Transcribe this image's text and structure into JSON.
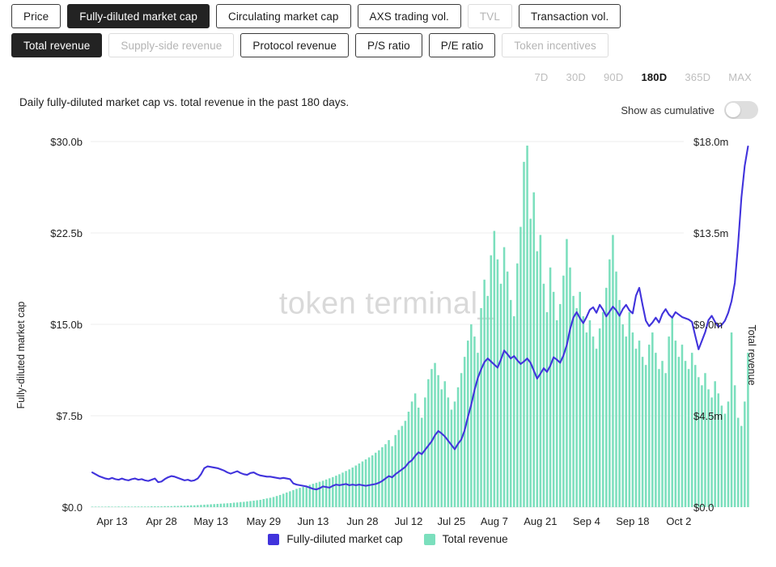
{
  "metric_tabs_row1": [
    {
      "label": "Price",
      "state": "normal"
    },
    {
      "label": "Fully-diluted market cap",
      "state": "active"
    },
    {
      "label": "Circulating market cap",
      "state": "normal"
    },
    {
      "label": "AXS trading vol.",
      "state": "normal"
    },
    {
      "label": "TVL",
      "state": "disabled"
    },
    {
      "label": "Transaction vol.",
      "state": "normal"
    }
  ],
  "metric_tabs_row2": [
    {
      "label": "Total revenue",
      "state": "active"
    },
    {
      "label": "Supply-side revenue",
      "state": "disabled"
    },
    {
      "label": "Protocol revenue",
      "state": "normal"
    },
    {
      "label": "P/S ratio",
      "state": "normal"
    },
    {
      "label": "P/E ratio",
      "state": "normal"
    },
    {
      "label": "Token incentives",
      "state": "disabled"
    }
  ],
  "ranges": [
    {
      "label": "7D",
      "active": false
    },
    {
      "label": "30D",
      "active": false
    },
    {
      "label": "90D",
      "active": false
    },
    {
      "label": "180D",
      "active": true
    },
    {
      "label": "365D",
      "active": false
    },
    {
      "label": "MAX",
      "active": false
    }
  ],
  "subtitle": "Daily fully-diluted market cap vs. total revenue in the past 180 days.",
  "cumulative_toggle": {
    "label": "Show as cumulative",
    "on": false
  },
  "watermark": "token terminal_",
  "legend": [
    {
      "label": "Fully-diluted market cap",
      "color": "#4133DC"
    },
    {
      "label": "Total revenue",
      "color": "#7BDFBD"
    }
  ],
  "colors": {
    "line": "#4133DC",
    "bar": "#7BDFBD",
    "grid": "#eeeeee",
    "text": "#1c1c1c",
    "muted": "#b4b4b4",
    "active_bg": "#232323"
  },
  "chart_data": {
    "type": "line",
    "title": "Daily fully-diluted market cap vs. total revenue in the past 180 days.",
    "xlabel": "",
    "ylabel": "Fully-diluted market cap",
    "y2label": "Total revenue",
    "ylim": [
      0,
      30
    ],
    "y2lim": [
      0,
      18
    ],
    "grid": true,
    "legend_position": "bottom-center",
    "y_ticks": [
      "$0.0",
      "$7.5b",
      "$15.0b",
      "$22.5b",
      "$30.0b"
    ],
    "y_tick_values": [
      0,
      7.5,
      15,
      22.5,
      30
    ],
    "y2_ticks": [
      "$0.0",
      "$4.5m",
      "$9.0m",
      "$13.5m",
      "$18.0m"
    ],
    "y2_tick_values": [
      0,
      4.5,
      9,
      13.5,
      18
    ],
    "x_tick_labels": [
      "Apr 13",
      "Apr 28",
      "May 13",
      "May 29",
      "Jun 13",
      "Jun 28",
      "Jul 12",
      "Jul 25",
      "Aug 7",
      "Aug 21",
      "Sep 4",
      "Sep 18",
      "Oct 2"
    ],
    "x_tick_indices": [
      6,
      21,
      36,
      52,
      67,
      82,
      96,
      109,
      122,
      136,
      150,
      164,
      178
    ],
    "n_points": 180,
    "series": [
      {
        "name": "Fully-diluted market cap",
        "unit": "billion USD",
        "axis": "left",
        "render": "line",
        "color": "#4133DC",
        "values": [
          2.85,
          2.7,
          2.55,
          2.45,
          2.35,
          2.3,
          2.4,
          2.3,
          2.25,
          2.35,
          2.25,
          2.2,
          2.3,
          2.35,
          2.25,
          2.3,
          2.2,
          2.15,
          2.25,
          2.35,
          2.05,
          2.1,
          2.3,
          2.45,
          2.55,
          2.5,
          2.4,
          2.3,
          2.2,
          2.25,
          2.15,
          2.2,
          2.35,
          2.7,
          3.2,
          3.35,
          3.3,
          3.25,
          3.2,
          3.1,
          3.0,
          2.85,
          2.75,
          2.85,
          2.95,
          2.8,
          2.7,
          2.65,
          2.8,
          2.85,
          2.7,
          2.6,
          2.55,
          2.5,
          2.5,
          2.45,
          2.4,
          2.35,
          2.4,
          2.35,
          2.3,
          1.95,
          1.85,
          1.8,
          1.75,
          1.7,
          1.6,
          1.5,
          1.45,
          1.55,
          1.7,
          1.65,
          1.6,
          1.75,
          1.85,
          1.8,
          1.85,
          1.9,
          1.8,
          1.85,
          1.8,
          1.85,
          1.8,
          1.75,
          1.8,
          1.85,
          1.9,
          2.0,
          2.15,
          2.35,
          2.55,
          2.45,
          2.7,
          2.9,
          3.1,
          3.3,
          3.65,
          3.85,
          4.2,
          4.5,
          4.35,
          4.7,
          5.05,
          5.4,
          5.9,
          6.25,
          6.05,
          5.8,
          5.45,
          5.1,
          4.75,
          5.2,
          5.55,
          6.3,
          7.4,
          8.4,
          9.6,
          10.6,
          11.3,
          11.9,
          12.2,
          11.95,
          11.7,
          11.45,
          12.1,
          12.85,
          12.55,
          12.2,
          12.4,
          12.05,
          11.75,
          11.95,
          12.2,
          11.85,
          11.2,
          10.55,
          10.95,
          11.4,
          11.1,
          11.6,
          12.3,
          12.1,
          11.85,
          12.45,
          13.3,
          14.6,
          15.55,
          16.0,
          15.5,
          15.1,
          15.6,
          16.2,
          16.4,
          15.95,
          16.6,
          16.2,
          15.65,
          16.05,
          16.45,
          16.15,
          15.7,
          16.25,
          16.6,
          16.15,
          15.9,
          17.35,
          18.0,
          16.6,
          15.3,
          14.85,
          15.15,
          15.55,
          15.15,
          15.85,
          16.25,
          15.8,
          15.55,
          16.0,
          15.8,
          15.6,
          15.5,
          15.4,
          15.2,
          14.05,
          12.95,
          13.65,
          14.35,
          15.35,
          15.7,
          15.2,
          14.8,
          14.95,
          15.3,
          15.95,
          16.9,
          18.4,
          21.6,
          25.4,
          28.0,
          29.6
        ]
      },
      {
        "name": "Total revenue",
        "unit": "million USD",
        "axis": "right",
        "render": "bar",
        "color": "#7BDFBD",
        "values": [
          0.02,
          0.02,
          0.02,
          0.02,
          0.02,
          0.03,
          0.02,
          0.02,
          0.03,
          0.02,
          0.03,
          0.03,
          0.02,
          0.03,
          0.03,
          0.03,
          0.03,
          0.03,
          0.04,
          0.04,
          0.04,
          0.04,
          0.05,
          0.05,
          0.05,
          0.06,
          0.06,
          0.07,
          0.07,
          0.08,
          0.09,
          0.09,
          0.1,
          0.11,
          0.12,
          0.13,
          0.14,
          0.15,
          0.16,
          0.17,
          0.18,
          0.19,
          0.2,
          0.22,
          0.23,
          0.25,
          0.26,
          0.28,
          0.3,
          0.32,
          0.34,
          0.36,
          0.4,
          0.43,
          0.46,
          0.5,
          0.55,
          0.6,
          0.66,
          0.72,
          0.78,
          0.84,
          0.9,
          0.95,
          1.0,
          1.05,
          1.1,
          1.15,
          1.2,
          1.25,
          1.3,
          1.36,
          1.42,
          1.48,
          1.55,
          1.62,
          1.7,
          1.78,
          1.86,
          1.95,
          2.05,
          2.15,
          2.25,
          2.35,
          2.45,
          2.55,
          2.68,
          2.8,
          2.95,
          3.1,
          3.3,
          3.0,
          3.55,
          3.8,
          4.0,
          4.25,
          4.7,
          5.2,
          5.6,
          4.9,
          4.4,
          5.4,
          6.3,
          6.8,
          7.1,
          6.5,
          5.8,
          6.2,
          5.4,
          4.8,
          5.2,
          5.9,
          6.6,
          7.4,
          8.2,
          9.0,
          8.4,
          7.6,
          9.8,
          11.2,
          10.4,
          12.4,
          13.6,
          12.2,
          11.0,
          12.8,
          11.6,
          10.2,
          9.4,
          12.0,
          13.8,
          17.0,
          17.8,
          14.2,
          15.5,
          12.6,
          13.4,
          11.0,
          9.6,
          11.8,
          10.6,
          9.2,
          10.0,
          11.4,
          13.2,
          11.8,
          10.4,
          9.8,
          10.6,
          9.4,
          8.6,
          9.2,
          8.4,
          7.8,
          8.8,
          9.6,
          10.8,
          12.2,
          13.4,
          11.6,
          10.2,
          9.0,
          8.4,
          9.6,
          8.6,
          7.8,
          8.2,
          7.4,
          7.0,
          8.0,
          8.6,
          7.6,
          6.8,
          7.2,
          6.6,
          8.4,
          9.4,
          8.2,
          7.4,
          8.0,
          7.2,
          6.8,
          7.6,
          7.0,
          6.4,
          6.0,
          6.6,
          5.8,
          5.4,
          6.2,
          5.6,
          5.0,
          4.6,
          5.2,
          8.6,
          6.0,
          4.4,
          4.0,
          5.2,
          7.6
        ]
      }
    ]
  }
}
